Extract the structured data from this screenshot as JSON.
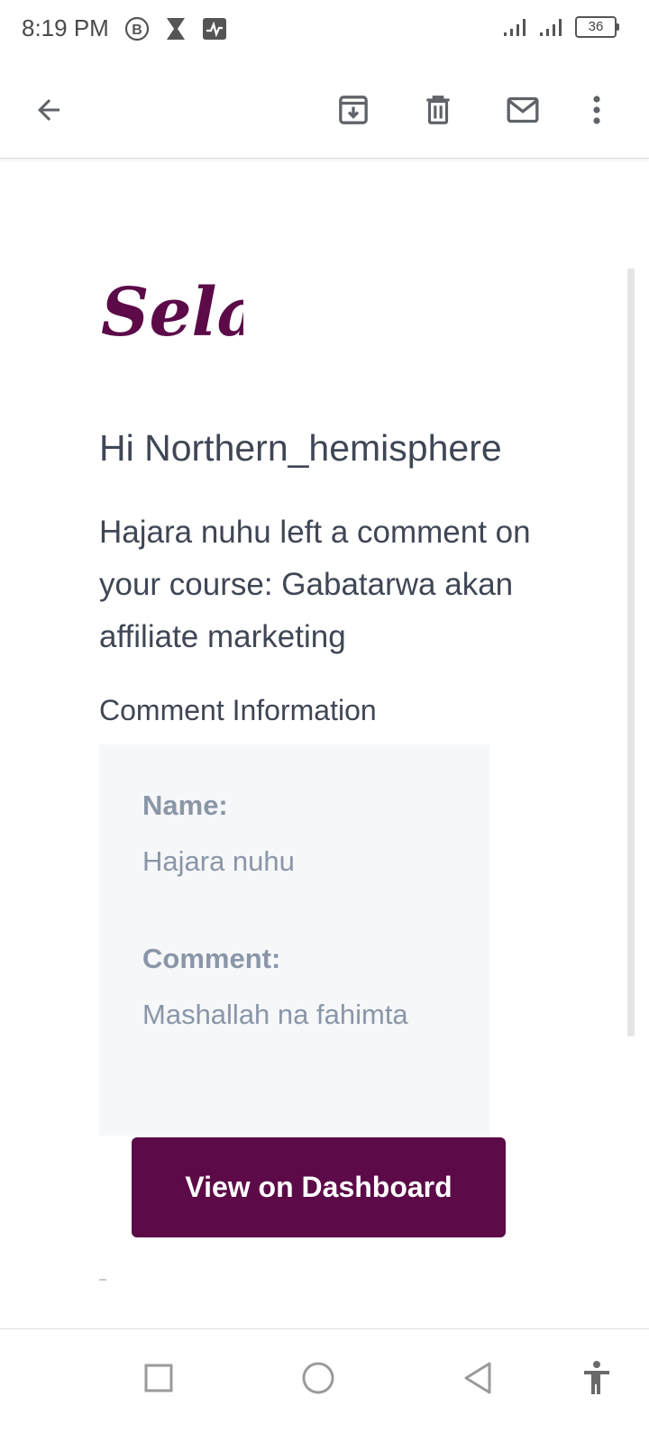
{
  "status_bar": {
    "time": "8:19 PM",
    "battery": "36",
    "icons": [
      "b-badge-icon",
      "hourglass-icon",
      "activity-icon",
      "signal-icon",
      "signal-icon",
      "battery-icon"
    ]
  },
  "toolbar": {
    "icons": [
      "back-arrow-icon",
      "archive-icon",
      "delete-icon",
      "mail-icon",
      "more-vert-icon"
    ]
  },
  "email": {
    "logo_text": "Selar",
    "greeting": "Hi Northern_hemisphere",
    "message": "Hajara nuhu left a comment on your course: Gabatarwa akan affiliate marketing",
    "section_title": "Comment Information",
    "name_label": "Name:",
    "name_value": "Hajara nuhu",
    "comment_label": "Comment:",
    "comment_value": "Mashallah na fahimta",
    "cta_label": "View on Dashboard"
  },
  "nav_bar": {
    "icons": [
      "recents-square-icon",
      "home-circle-icon",
      "back-triangle-icon",
      "accessibility-icon"
    ]
  },
  "colors": {
    "brand": "#5c0b48",
    "text_primary": "#3f4655",
    "text_muted": "#8a96a8",
    "card_bg": "#f6f7f9"
  }
}
